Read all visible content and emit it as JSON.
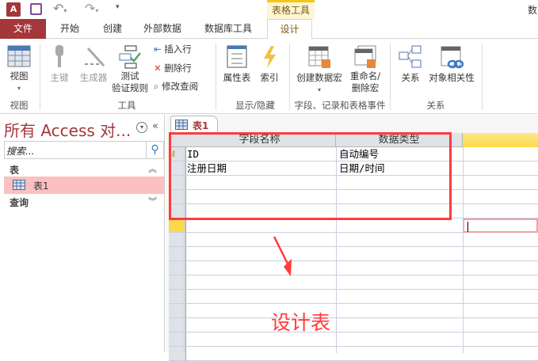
{
  "app": {
    "title_partial": "数",
    "contextual_tab_group": "表格工具"
  },
  "tabs": [
    {
      "label": "文件"
    },
    {
      "label": "开始"
    },
    {
      "label": "创建"
    },
    {
      "label": "外部数据"
    },
    {
      "label": "数据库工具"
    },
    {
      "label": "设计"
    }
  ],
  "ribbon": {
    "view": {
      "label": "视图",
      "group": "视图"
    },
    "tools": {
      "primary_key": "主键",
      "builder": "生成器",
      "test_rules_1": "测试",
      "test_rules_2": "验证规则",
      "insert_row": "插入行",
      "delete_row": "删除行",
      "modify_lookups": "修改查阅",
      "group": "工具"
    },
    "show_hide": {
      "property_sheet": "属性表",
      "indexes": "索引",
      "group": "显示/隐藏"
    },
    "events": {
      "create_macro": "创建数据宏",
      "rename_macro_1": "重命名/",
      "rename_macro_2": "删除宏",
      "group": "字段、记录和表格事件"
    },
    "relationships": {
      "relationships": "关系",
      "dependencies": "对象相关性",
      "group": "关系"
    }
  },
  "nav": {
    "title": "所有 Access 对...",
    "search_placeholder": "搜索...",
    "sections": [
      {
        "label": "表",
        "items": [
          {
            "label": "表1"
          }
        ]
      },
      {
        "label": "查询",
        "items": []
      }
    ]
  },
  "document": {
    "tab_label": "表1",
    "columns": [
      "字段名称",
      "数据类型"
    ],
    "rows": [
      {
        "field": "ID",
        "type": "自动编号",
        "primary_key": true
      },
      {
        "field": "注册日期",
        "type": "日期/时间"
      }
    ]
  },
  "annotation": {
    "text": "设计表",
    "color": "#ff3b3b"
  }
}
